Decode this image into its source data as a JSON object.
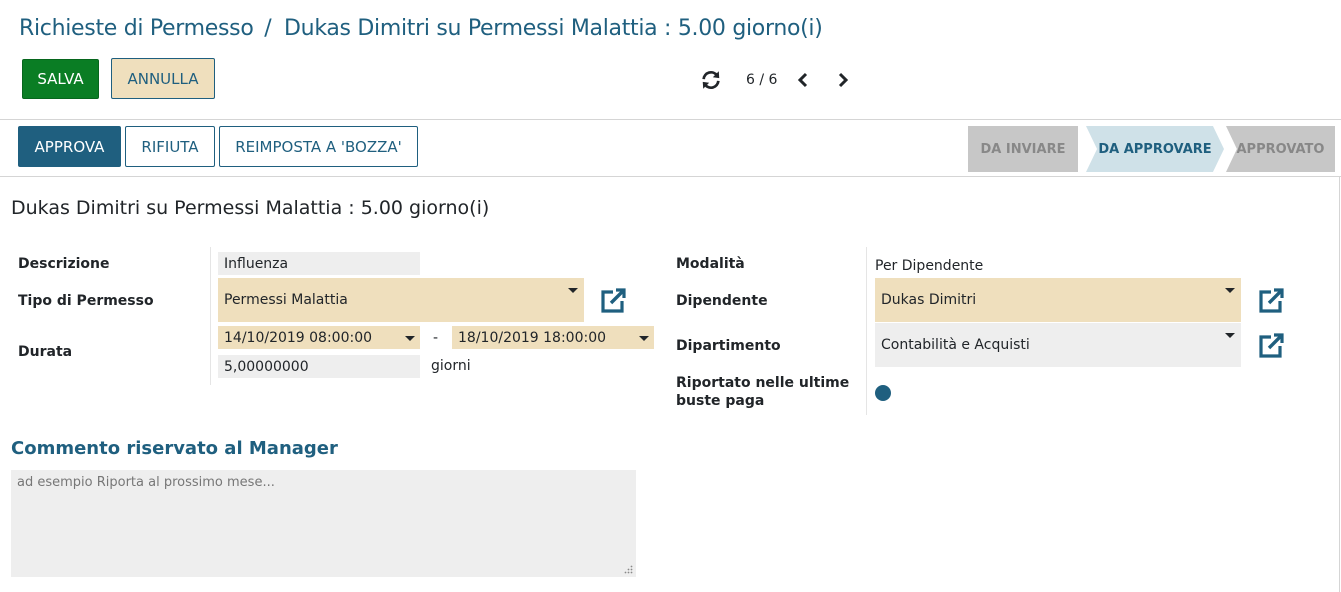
{
  "breadcrumb": {
    "parent": "Richieste di Permesso",
    "separator": "/",
    "current": "Dukas Dimitri su Permessi Malattia : 5.00 giorno(i)"
  },
  "control_panel": {
    "save_label": "SALVA",
    "discard_label": "ANNULLA",
    "pager_value": "6 / 6"
  },
  "statusbar": {
    "buttons": {
      "approve": "APPROVA",
      "refuse": "RIFIUTA",
      "reset_draft": "REIMPOSTA A 'BOZZA'"
    },
    "stages": [
      {
        "label": "DA INVIARE",
        "active": false
      },
      {
        "label": "DA APPROVARE",
        "active": true
      },
      {
        "label": "APPROVATO",
        "active": false
      }
    ]
  },
  "record": {
    "title": "Dukas Dimitri su Permessi Malattia : 5.00 giorno(i)",
    "left": {
      "description_label": "Descrizione",
      "description_value": "Influenza",
      "leave_type_label": "Tipo di Permesso",
      "leave_type_value": "Permessi Malattia",
      "duration_label": "Durata",
      "date_from": "14/10/2019 08:00:00",
      "date_separator": "-",
      "date_to": "18/10/2019 18:00:00",
      "days_value": "5,00000000",
      "days_unit": "giorni"
    },
    "right": {
      "mode_label": "Modalità",
      "mode_value": "Per Dipendente",
      "employee_label": "Dipendente",
      "employee_value": "Dukas Dimitri",
      "department_label": "Dipartimento",
      "department_value": "Contabilità e Acquisti",
      "payslip_label": "Riportato nelle ultime buste paga",
      "payslip_value": false
    }
  },
  "manager_note": {
    "title": "Commento riservato al Manager",
    "placeholder": "ad esempio Riporta al prossimo mese..."
  },
  "colors": {
    "primary": "#1f5f7f",
    "save_green": "#0a7d24",
    "required_bg": "#efdfbd",
    "readonly_bg": "#eeeeee",
    "active_stage_bg": "#cfe1e8",
    "inactive_stage_bg": "#c7c7c7"
  },
  "icons": {
    "refresh": "refresh-icon",
    "prev": "chevron-left-icon",
    "next": "chevron-right-icon",
    "external_link": "external-link-icon"
  }
}
